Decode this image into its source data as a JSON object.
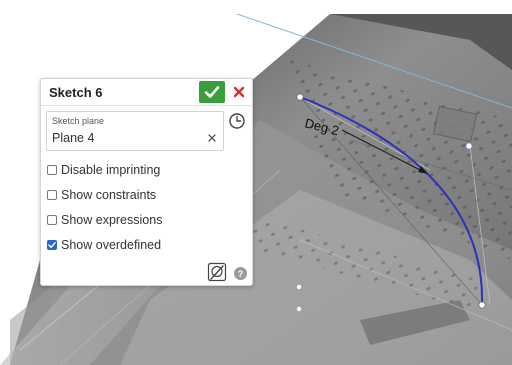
{
  "panel": {
    "title": "Sketch 6",
    "sketch_plane": {
      "label": "Sketch plane",
      "value": "Plane 4"
    },
    "options": [
      {
        "label": "Disable imprinting",
        "checked": false
      },
      {
        "label": "Show constraints",
        "checked": false
      },
      {
        "label": "Show expressions",
        "checked": false
      },
      {
        "label": "Show overdefined",
        "checked": true
      }
    ]
  },
  "viewport": {
    "dimension_label": "Deg 2"
  },
  "colors": {
    "accept": "#37a03b",
    "cancel": "#d9302c",
    "checkbox_checked": "#2a64c8",
    "curve": "#2b33b8",
    "model_gray": "#8c8c8c"
  },
  "icons": [
    "check-icon",
    "close-icon",
    "clear-icon",
    "clock-icon",
    "sketch-tool-icon",
    "help-icon"
  ]
}
